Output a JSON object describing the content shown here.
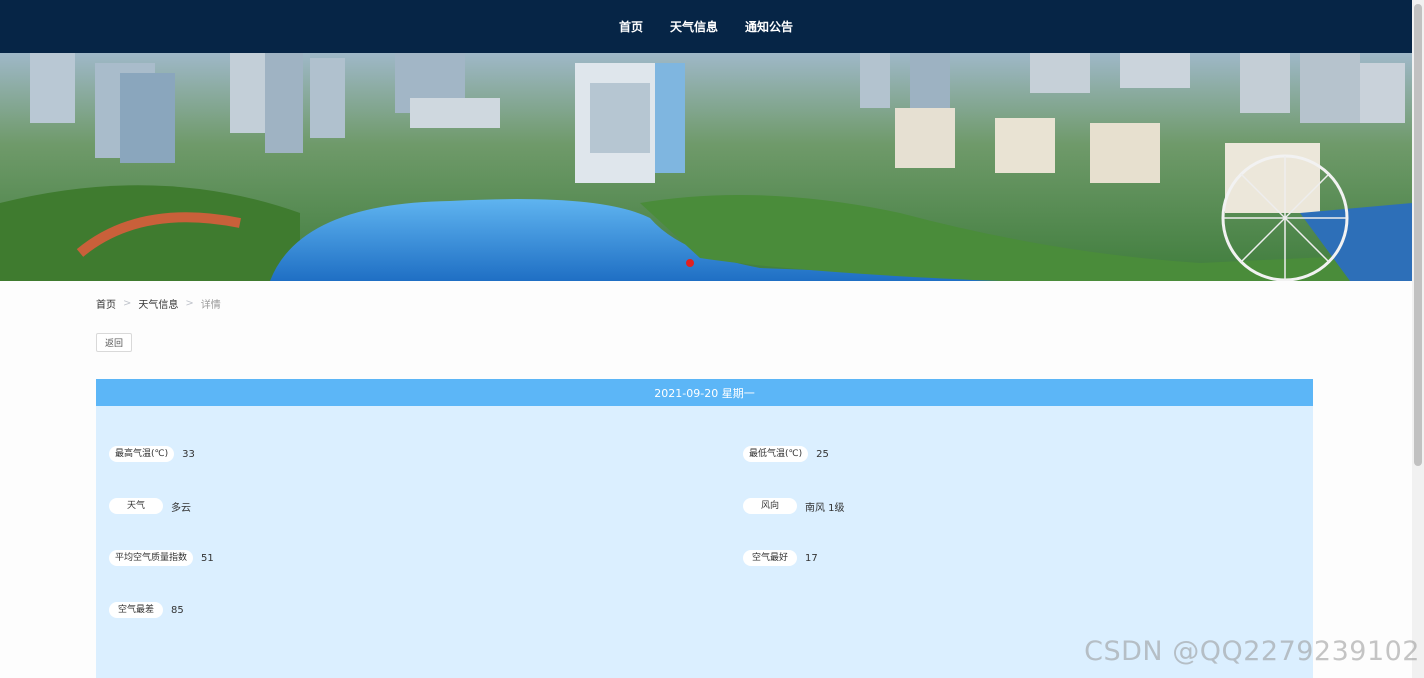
{
  "nav": {
    "items": [
      {
        "label": "首页"
      },
      {
        "label": "天气信息"
      },
      {
        "label": "通知公告"
      }
    ]
  },
  "breadcrumb": {
    "home": "首页",
    "sep": ">",
    "section": "天气信息",
    "current": "详情"
  },
  "back_button": "返回",
  "detail": {
    "header": "2021-09-20 星期一",
    "fields": [
      {
        "label": "最高气温(℃)",
        "value": "33"
      },
      {
        "label": "最低气温(℃)",
        "value": "25"
      },
      {
        "label": "天气",
        "value": "多云"
      },
      {
        "label": "风向",
        "value": "南风 1级"
      },
      {
        "label": "平均空气质量指数",
        "value": "51"
      },
      {
        "label": "空气最好",
        "value": "17"
      },
      {
        "label": "空气最差",
        "value": "85"
      }
    ]
  },
  "watermark": "CSDN @QQ2279239102",
  "colors": {
    "nav_bg": "#062546",
    "panel_header": "#5cb6f7",
    "panel_bg": "#dbefff"
  }
}
